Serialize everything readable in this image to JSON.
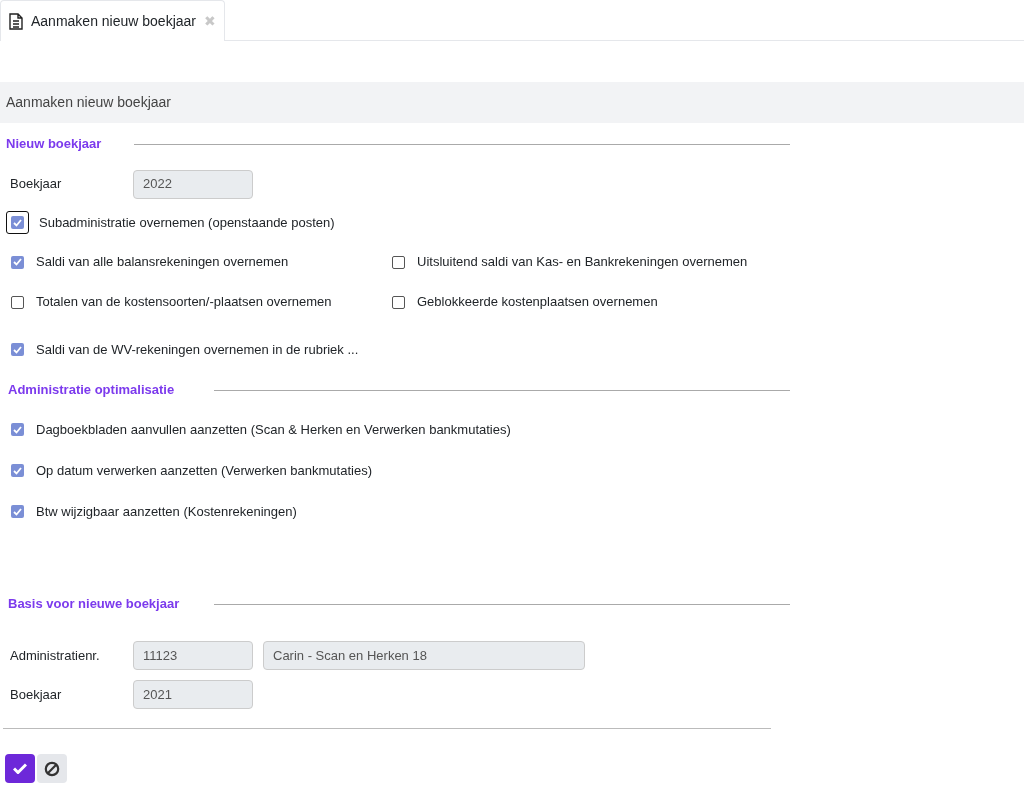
{
  "tab": {
    "label": "Aanmaken nieuw boekjaar",
    "close": "✖"
  },
  "header": {
    "title": "Aanmaken nieuw boekjaar"
  },
  "sections": [
    {
      "title": "Nieuw boekjaar",
      "rows": [
        {
          "kind": "field",
          "label": "Boekjaar",
          "values": [
            "2022"
          ]
        },
        {
          "kind": "checks",
          "items": [
            {
              "label": "Subadministratie overnemen (openstaande posten)",
              "checked": true,
              "focused": true
            }
          ]
        },
        {
          "kind": "checks",
          "items": [
            {
              "label": "Saldi van alle balansrekeningen overnemen",
              "checked": true,
              "focused": false
            },
            {
              "label": "Uitsluitend saldi van Kas- en Bankrekeningen overnemen",
              "checked": false,
              "focused": false
            }
          ]
        },
        {
          "kind": "checks",
          "items": [
            {
              "label": "Totalen van de kostensoorten/-plaatsen overnemen",
              "checked": false,
              "focused": false
            },
            {
              "label": "Geblokkeerde kostenplaatsen overnemen",
              "checked": false,
              "focused": false
            }
          ]
        },
        {
          "kind": "checks",
          "items": [
            {
              "label": "Saldi van de WV-rekeningen overnemen in de rubriek ...",
              "checked": true,
              "focused": false
            }
          ]
        }
      ]
    },
    {
      "title": "Administratie optimalisatie",
      "rows": [
        {
          "kind": "checks",
          "items": [
            {
              "label": "Dagboekbladen aanvullen aanzetten (Scan & Herken en Verwerken bankmutaties)",
              "checked": true,
              "focused": false
            }
          ]
        },
        {
          "kind": "checks",
          "items": [
            {
              "label": "Op datum verwerken aanzetten (Verwerken bankmutaties)",
              "checked": true,
              "focused": false
            }
          ]
        },
        {
          "kind": "checks",
          "items": [
            {
              "label": "Btw wijzigbaar aanzetten (Kostenrekeningen)",
              "checked": true,
              "focused": false
            }
          ]
        }
      ]
    },
    {
      "title": "Basis voor nieuwe boekjaar",
      "rows": [
        {
          "kind": "field",
          "label": "Administratienr.",
          "values": [
            "11123",
            "Carin - Scan en Herken 18"
          ]
        },
        {
          "kind": "field",
          "label": "Boekjaar",
          "values": [
            "2021"
          ]
        }
      ]
    }
  ],
  "buttons": [
    {
      "kind": "confirm"
    },
    {
      "kind": "cancel"
    }
  ]
}
